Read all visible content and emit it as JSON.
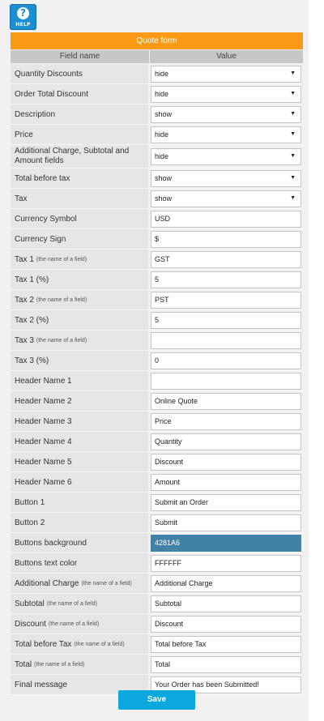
{
  "help": {
    "label": "HELP"
  },
  "form": {
    "title": "Quote form",
    "columns": {
      "name": "Field name",
      "value": "Value"
    },
    "rows": [
      {
        "label": "Quantity Discounts",
        "sub": "",
        "type": "select",
        "value": "hide"
      },
      {
        "label": "Order Total Discount",
        "sub": "",
        "type": "select",
        "value": "hide"
      },
      {
        "label": "Description",
        "sub": "",
        "type": "select",
        "value": "show"
      },
      {
        "label": "Price",
        "sub": "",
        "type": "select",
        "value": "hide"
      },
      {
        "label": "Additional Charge, Subtotal and Amount fields",
        "sub": "",
        "type": "select",
        "value": "hide"
      },
      {
        "label": "Total before tax",
        "sub": "",
        "type": "select",
        "value": "show"
      },
      {
        "label": "Tax",
        "sub": "",
        "type": "select",
        "value": "show"
      },
      {
        "label": "Currency Symbol",
        "sub": "",
        "type": "input",
        "value": "USD"
      },
      {
        "label": "Currency Sign",
        "sub": "",
        "type": "input",
        "value": "$"
      },
      {
        "label": "Tax 1",
        "sub": "(the name of a field)",
        "type": "input",
        "value": "GST"
      },
      {
        "label": "Tax 1 (%)",
        "sub": "",
        "type": "input",
        "value": "5"
      },
      {
        "label": "Tax 2",
        "sub": "(the name of a field)",
        "type": "input",
        "value": "PST"
      },
      {
        "label": "Tax 2 (%)",
        "sub": "",
        "type": "input",
        "value": "5"
      },
      {
        "label": "Tax 3",
        "sub": "(the name of a field)",
        "type": "input",
        "value": ""
      },
      {
        "label": "Tax 3 (%)",
        "sub": "",
        "type": "input",
        "value": "0"
      },
      {
        "label": "Header Name 1",
        "sub": "",
        "type": "input",
        "value": ""
      },
      {
        "label": "Header Name 2",
        "sub": "",
        "type": "input",
        "value": "Online Quote"
      },
      {
        "label": "Header Name 3",
        "sub": "",
        "type": "input",
        "value": "Price"
      },
      {
        "label": "Header Name 4",
        "sub": "",
        "type": "input",
        "value": "Quantity"
      },
      {
        "label": "Header Name 5",
        "sub": "",
        "type": "input",
        "value": "Discount"
      },
      {
        "label": "Header Name 6",
        "sub": "",
        "type": "input",
        "value": "Amount"
      },
      {
        "label": "Button 1",
        "sub": "",
        "type": "input",
        "value": "Submit an Order"
      },
      {
        "label": "Button 2",
        "sub": "",
        "type": "input",
        "value": "Submit"
      },
      {
        "label": "Buttons background",
        "sub": "",
        "type": "color",
        "value": "4281A6",
        "color": "#4281a6"
      },
      {
        "label": "Buttons text color",
        "sub": "",
        "type": "input",
        "value": "FFFFFF"
      },
      {
        "label": "Additional Charge",
        "sub": "(the name of a field)",
        "type": "input",
        "value": "Additional Charge"
      },
      {
        "label": "Subtotal",
        "sub": "(the name of a field)",
        "type": "input",
        "value": "Subtotal"
      },
      {
        "label": "Discount",
        "sub": "(the name of a field)",
        "type": "input",
        "value": "Discount"
      },
      {
        "label": "Total before Tax",
        "sub": "(the name of a field)",
        "type": "input",
        "value": "Total before Tax"
      },
      {
        "label": "Total",
        "sub": "(the name of a field)",
        "type": "input",
        "value": "Total"
      },
      {
        "label": "Final message",
        "sub": "",
        "type": "input",
        "value": "Your Order has been Submitted!"
      }
    ],
    "save_label": "Save"
  },
  "colors": {
    "title_bar": "#fb9a17",
    "save_button": "#0ca8dd",
    "help_button": "#1b8fd0"
  }
}
